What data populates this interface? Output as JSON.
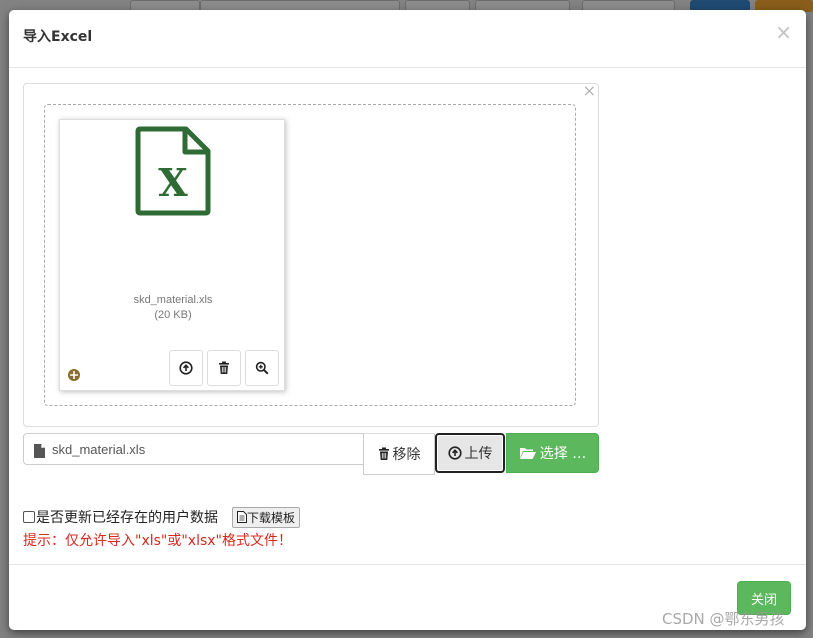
{
  "modal": {
    "title": "导入Excel",
    "close_glyph": "×"
  },
  "preview": {
    "close_glyph": "×",
    "file": {
      "icon": "file-excel-icon",
      "name": "skd_material.xls",
      "size": "(20 KB)"
    },
    "actions": [
      "upload-icon",
      "trash-icon",
      "zoom-in-icon"
    ]
  },
  "input_group": {
    "caption_text": "skd_material.xls",
    "remove_label": "移除",
    "upload_label": "上传",
    "choose_label": "选择 …"
  },
  "options": {
    "update_existing_label": "是否更新已经存在的用户数据",
    "update_existing_checked": false,
    "download_template_label": "下载模板"
  },
  "hint": "提示：仅允许导入\"xls\"或\"xlsx\"格式文件！",
  "footer": {
    "close_label": "关闭"
  },
  "watermark": "CSDN @鄂东男孩",
  "colors": {
    "excel_green": "#2f6b35",
    "success_green": "#5cb85c",
    "hint_red": "#d9281e"
  }
}
